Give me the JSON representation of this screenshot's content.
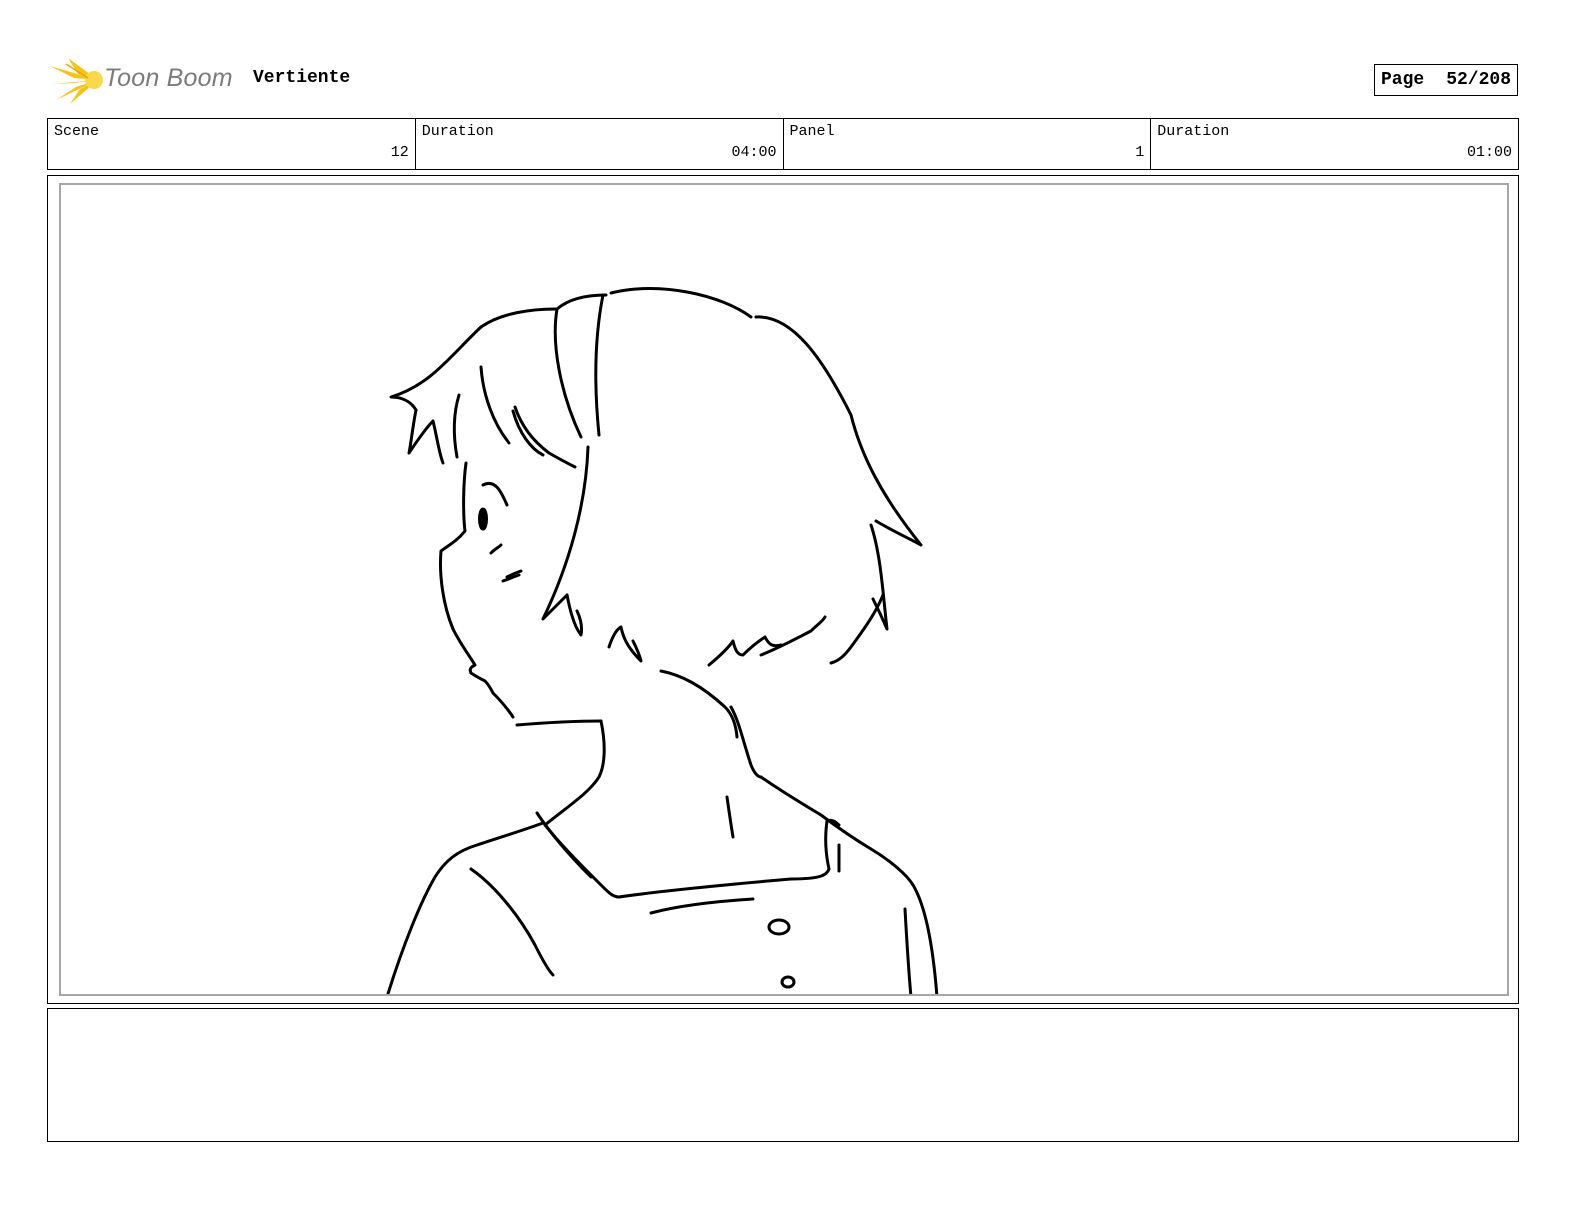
{
  "header": {
    "logo": {
      "icon": "toon-boom-starburst-icon",
      "text": "Toon Boom",
      "text_color": "#7b7b7b",
      "accent": "#f7c316"
    },
    "project_title": "Vertiente",
    "page": {
      "label": "Page",
      "value": "52/208"
    }
  },
  "info": {
    "scene": {
      "label": "Scene",
      "value": "12"
    },
    "scene_duration": {
      "label": "Duration",
      "value": "04:00"
    },
    "panel": {
      "label": "Panel",
      "value": "1"
    },
    "panel_duration": {
      "label": "Duration",
      "value": "01:00"
    }
  },
  "panel_image": {
    "subject": "line-sketch-girl-profile",
    "frame_color": "#a6a6a6"
  },
  "notes": {
    "text": ""
  }
}
